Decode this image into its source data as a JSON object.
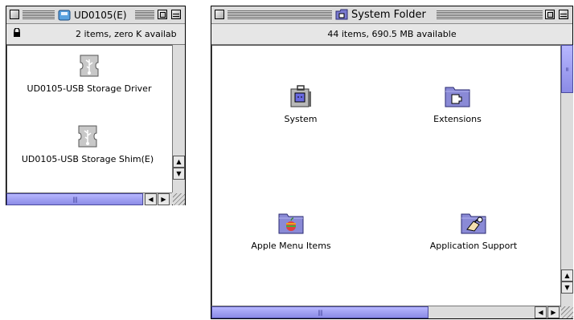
{
  "windows": {
    "udo": {
      "title": "UD0105(E)",
      "info": "2 items, zero K availab",
      "items": [
        {
          "label": "UD0105-USB Storage Driver",
          "icon": "usb-driver-icon"
        },
        {
          "label": "UD0105-USB Storage Shim(E)",
          "icon": "usb-driver-icon"
        }
      ]
    },
    "system": {
      "title": "System Folder",
      "info": "44 items, 690.5 MB available",
      "items": [
        {
          "label": "System",
          "icon": "system-suitcase-icon"
        },
        {
          "label": "Extensions",
          "icon": "extensions-folder-icon"
        },
        {
          "label": "Apple Menu Items",
          "icon": "apple-menu-folder-icon"
        },
        {
          "label": "Application Support",
          "icon": "application-support-folder-icon"
        }
      ]
    }
  },
  "colors": {
    "scroll_thumb": "#9a9aef",
    "folder": "#8a8ad6",
    "desktop": "#ffffff"
  }
}
